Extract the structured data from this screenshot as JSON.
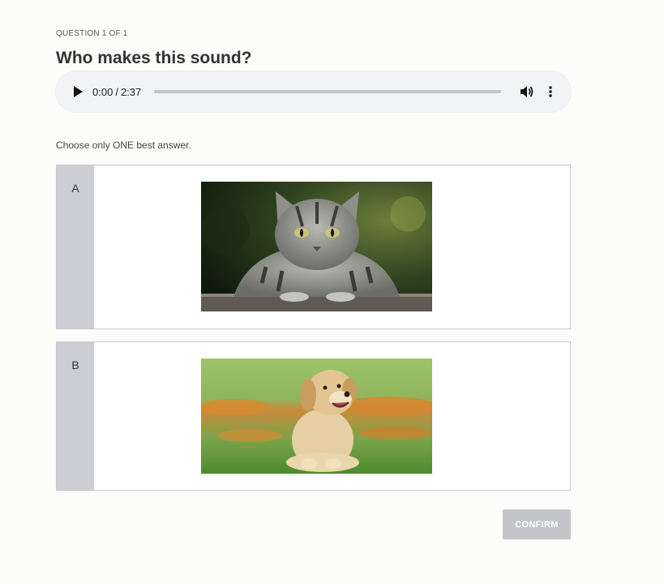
{
  "question": {
    "counter": "QUESTION 1 OF 1",
    "title": "Who makes this sound?"
  },
  "audio_player": {
    "current_time": "0:00",
    "separator": "/",
    "duration": "2:37",
    "progress": 0,
    "icons": {
      "play": "play-icon",
      "volume": "volume-icon",
      "more": "more-vertical-icon"
    }
  },
  "instruction": "Choose only ONE best answer.",
  "options": [
    {
      "letter": "A",
      "image": "cat-photo"
    },
    {
      "letter": "B",
      "image": "dog-photo"
    }
  ],
  "confirm_label": "CONFIRM",
  "colors": {
    "letter_column": "#cdced3",
    "confirm_disabled": "#c4c5c9",
    "player_bg": "#f1f3f4"
  }
}
